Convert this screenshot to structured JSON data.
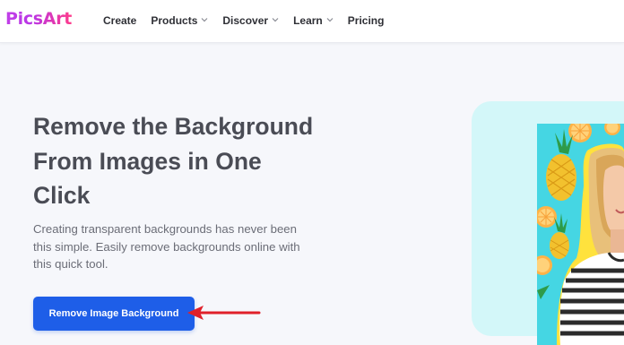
{
  "brand": {
    "name": "PicsArt"
  },
  "nav": {
    "items": [
      {
        "label": "Create",
        "dropdown": false
      },
      {
        "label": "Products",
        "dropdown": true
      },
      {
        "label": "Discover",
        "dropdown": true
      },
      {
        "label": "Learn",
        "dropdown": true
      },
      {
        "label": "Pricing",
        "dropdown": false
      }
    ]
  },
  "hero": {
    "title_lines": [
      "Remove the Background",
      "From Images in One",
      "Click"
    ],
    "description_lines": [
      "Creating transparent backgrounds has never been",
      "this simple. Easily remove backgrounds online with",
      "this quick tool."
    ],
    "cta_label": "Remove Image Background"
  },
  "colors": {
    "brand_gradient_start": "#c13fe8",
    "brand_gradient_end": "#ff3b8a",
    "cta": "#1e5ee8",
    "annotation_arrow": "#e0202a",
    "teal_panel": "#d3f7f9",
    "photo_background": "#45d6e3"
  },
  "icons": {
    "dropdown": "chevron-down-icon",
    "annotation": "red-arrow-icon"
  }
}
